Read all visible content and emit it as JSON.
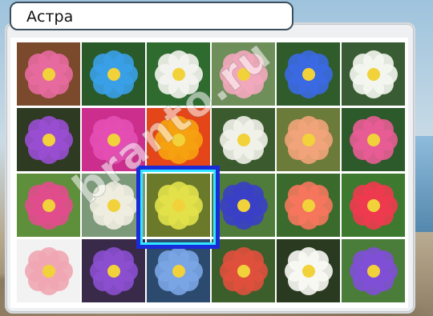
{
  "answer": {
    "title": "Астра"
  },
  "watermark": "branto.ru",
  "grid": {
    "rows": 4,
    "cols": 6,
    "selected": {
      "row": 3,
      "col": 3
    },
    "tiles": [
      {
        "icon": "pink-orchid-icon",
        "bg": "#7b4a2c",
        "color": "#e86aa0"
      },
      {
        "icon": "blue-cornflower-icon",
        "bg": "#2a5a2a",
        "color": "#3aa0e8"
      },
      {
        "icon": "white-calla-icon",
        "bg": "#2f6b2f",
        "color": "#f4f4f0"
      },
      {
        "icon": "pink-rose-icon",
        "bg": "#6f8f5a",
        "color": "#f3a8bc"
      },
      {
        "icon": "blue-forget-me-not-icon",
        "bg": "#2f5c2a",
        "color": "#3b69e3"
      },
      {
        "icon": "white-chrysanthemum-icon",
        "bg": "#3a5c34",
        "color": "#f5f7f0"
      },
      {
        "icon": "purple-primrose-icon",
        "bg": "#2f3a22",
        "color": "#9a4fd4"
      },
      {
        "icon": "magenta-dahlia-icon",
        "bg": "#cb2e8d",
        "color": "#e44fb4"
      },
      {
        "icon": "orange-gerbera-icon",
        "bg": "#e4461a",
        "color": "#f6a20f"
      },
      {
        "icon": "white-narcissus-icon",
        "bg": "#3b5a2e",
        "color": "#f2f2ea"
      },
      {
        "icon": "peach-lily-icon",
        "bg": "#6b7b3a",
        "color": "#f2a37a"
      },
      {
        "icon": "pink-daisy-icon",
        "bg": "#2c5a2a",
        "color": "#e95c95"
      },
      {
        "icon": "pink-carnation-icon",
        "bg": "#5e8f3a",
        "color": "#e24d8d"
      },
      {
        "icon": "white-orchid-icon",
        "bg": "#7c9a7a",
        "color": "#f0ede0"
      },
      {
        "icon": "yellow-aster-icon",
        "bg": "#6a7a2a",
        "color": "#e3e24a"
      },
      {
        "icon": "blue-iris-icon",
        "bg": "#4f7c3a",
        "color": "#3a3fc7"
      },
      {
        "icon": "coral-peony-icon",
        "bg": "#3a6a2c",
        "color": "#f6775d"
      },
      {
        "icon": "tulip-mix-icon",
        "bg": "#3d7a2f",
        "color": "#ef3a4f"
      },
      {
        "icon": "white-alstroemeria-icon",
        "bg": "#f2f2f2",
        "color": "#f0a6b3"
      },
      {
        "icon": "purple-hyacinth-icon",
        "bg": "#3a2a4a",
        "color": "#8b4fd0"
      },
      {
        "icon": "blue-plumbago-icon",
        "bg": "#2c4a6e",
        "color": "#7aa6e6"
      },
      {
        "icon": "gladiolus-icon",
        "bg": "#3c5e2b",
        "color": "#e0503d"
      },
      {
        "icon": "white-snowdrop-icon",
        "bg": "#2a3a20",
        "color": "#fafaf5"
      },
      {
        "icon": "purple-crocus-icon",
        "bg": "#4a7d3a",
        "color": "#7f4fd7"
      }
    ]
  }
}
